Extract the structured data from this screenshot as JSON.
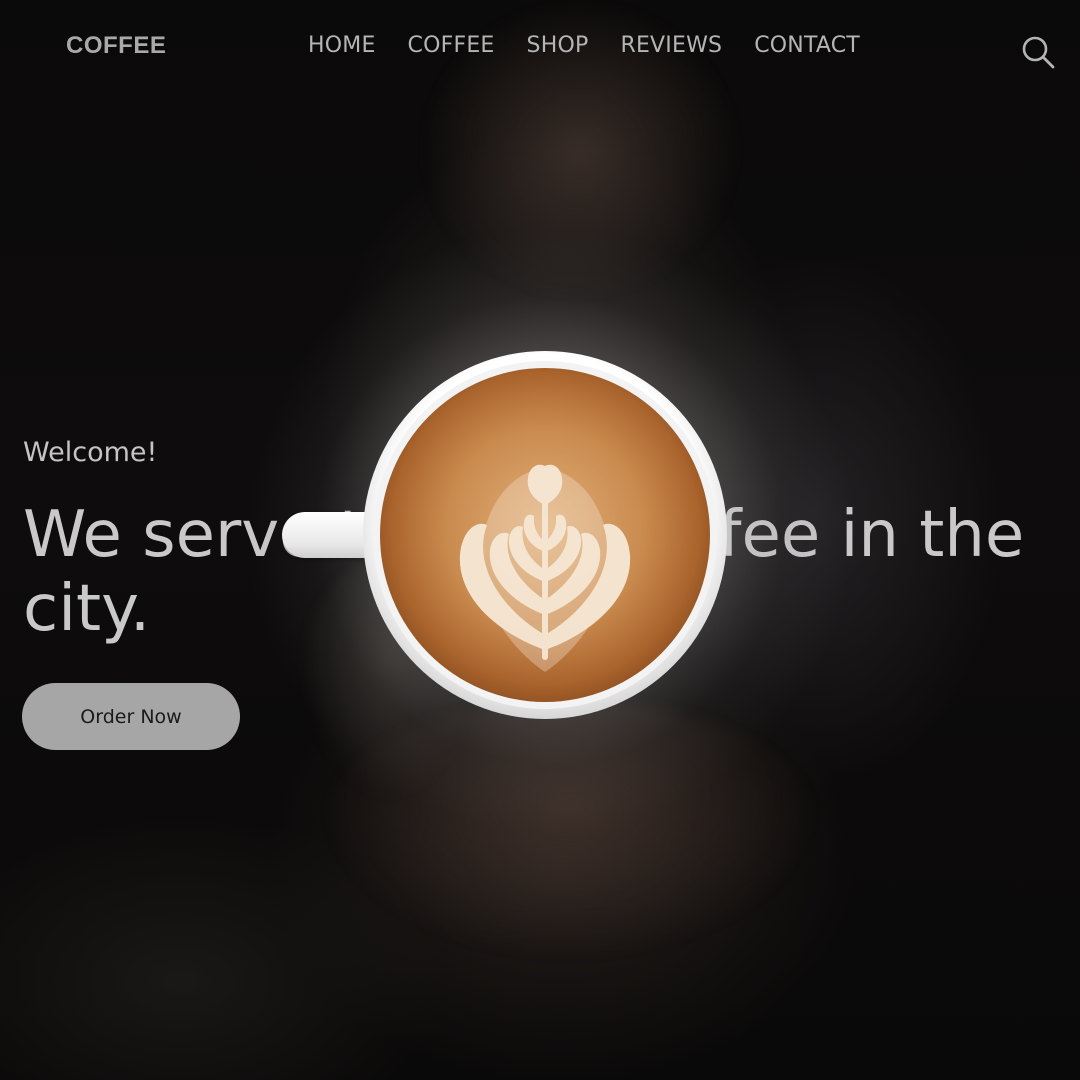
{
  "nav": {
    "logo": "COFFEE",
    "items": [
      {
        "label": "HOME"
      },
      {
        "label": "COFFEE"
      },
      {
        "label": "SHOP"
      },
      {
        "label": "REVIEWS"
      },
      {
        "label": "CONTACT"
      }
    ],
    "search_icon": "search-icon"
  },
  "hero": {
    "welcome": "Welcome!",
    "headline": "We serve the best coffee in the city.",
    "cta_label": "Order Now"
  },
  "colors": {
    "background": "#0b0a0a",
    "text_primary": "#c9c9c9",
    "nav_text": "#b5b5b5",
    "button_bg": "#a6a6a6",
    "coffee_crema": "#c7854a"
  }
}
